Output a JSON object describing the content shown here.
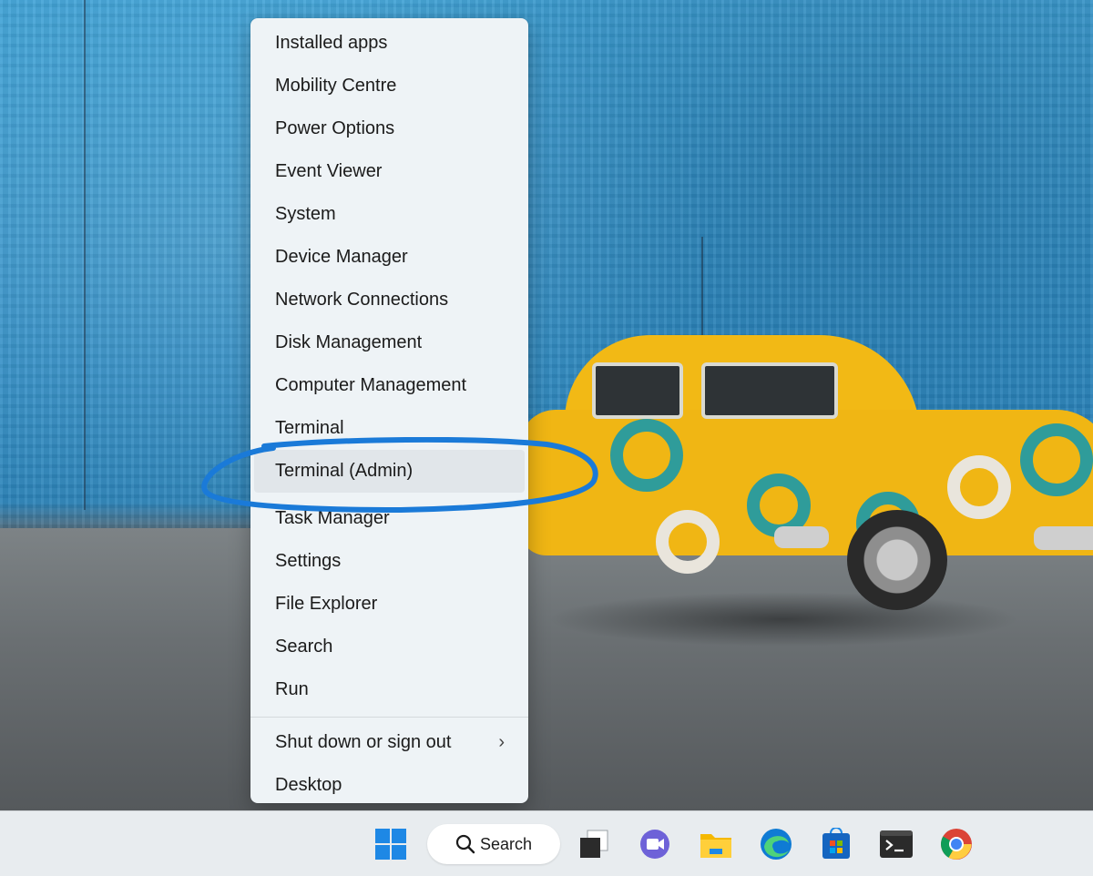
{
  "menu": {
    "items": [
      {
        "label": "Installed apps"
      },
      {
        "label": "Mobility Centre"
      },
      {
        "label": "Power Options"
      },
      {
        "label": "Event Viewer"
      },
      {
        "label": "System"
      },
      {
        "label": "Device Manager"
      },
      {
        "label": "Network Connections"
      },
      {
        "label": "Disk Management"
      },
      {
        "label": "Computer Management"
      },
      {
        "label": "Terminal"
      },
      {
        "label": "Terminal (Admin)",
        "highlighted": true
      },
      {
        "label": "Task Manager"
      },
      {
        "label": "Settings"
      },
      {
        "label": "File Explorer"
      },
      {
        "label": "Search"
      },
      {
        "label": "Run"
      }
    ],
    "bottom_items": [
      {
        "label": "Shut down or sign out",
        "has_submenu": true,
        "chevron": "›"
      },
      {
        "label": "Desktop"
      }
    ]
  },
  "taskbar": {
    "search_label": "Search",
    "apps": [
      {
        "name": "start-icon"
      },
      {
        "name": "task-view-icon"
      },
      {
        "name": "meet-icon"
      },
      {
        "name": "file-explorer-icon"
      },
      {
        "name": "edge-icon"
      },
      {
        "name": "store-icon"
      },
      {
        "name": "terminal-icon"
      },
      {
        "name": "chrome-icon"
      }
    ]
  },
  "colors": {
    "menu_background": "#eef3f6",
    "highlight_background": "#e1e6ea",
    "annotation_stroke": "#1a7ad8",
    "taskbar_background": "#e8ecef",
    "windows_blue": "#1e88e5"
  }
}
